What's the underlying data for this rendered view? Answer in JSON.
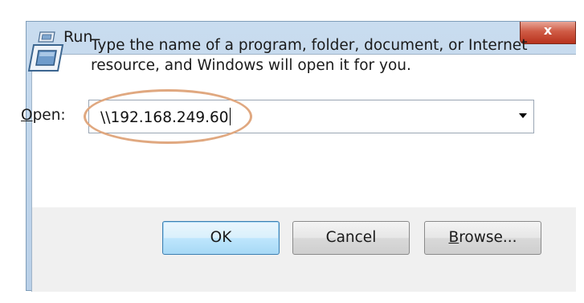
{
  "window": {
    "title": "Run",
    "close_glyph": "x"
  },
  "dialog": {
    "description": "Type the name of a program, folder, document, or Internet resource, and Windows will open it for you.",
    "open_label_accel": "O",
    "open_label_rest": "pen:",
    "open_value": "\\\\192.168.249.60",
    "highlight_color": "#e0a880"
  },
  "buttons": {
    "ok_label": "OK",
    "cancel_label": "Cancel",
    "browse_accel": "B",
    "browse_rest": "rowse..."
  },
  "icons": {
    "title": "run-icon",
    "main": "run-icon",
    "combo": "chevron-down-icon"
  }
}
